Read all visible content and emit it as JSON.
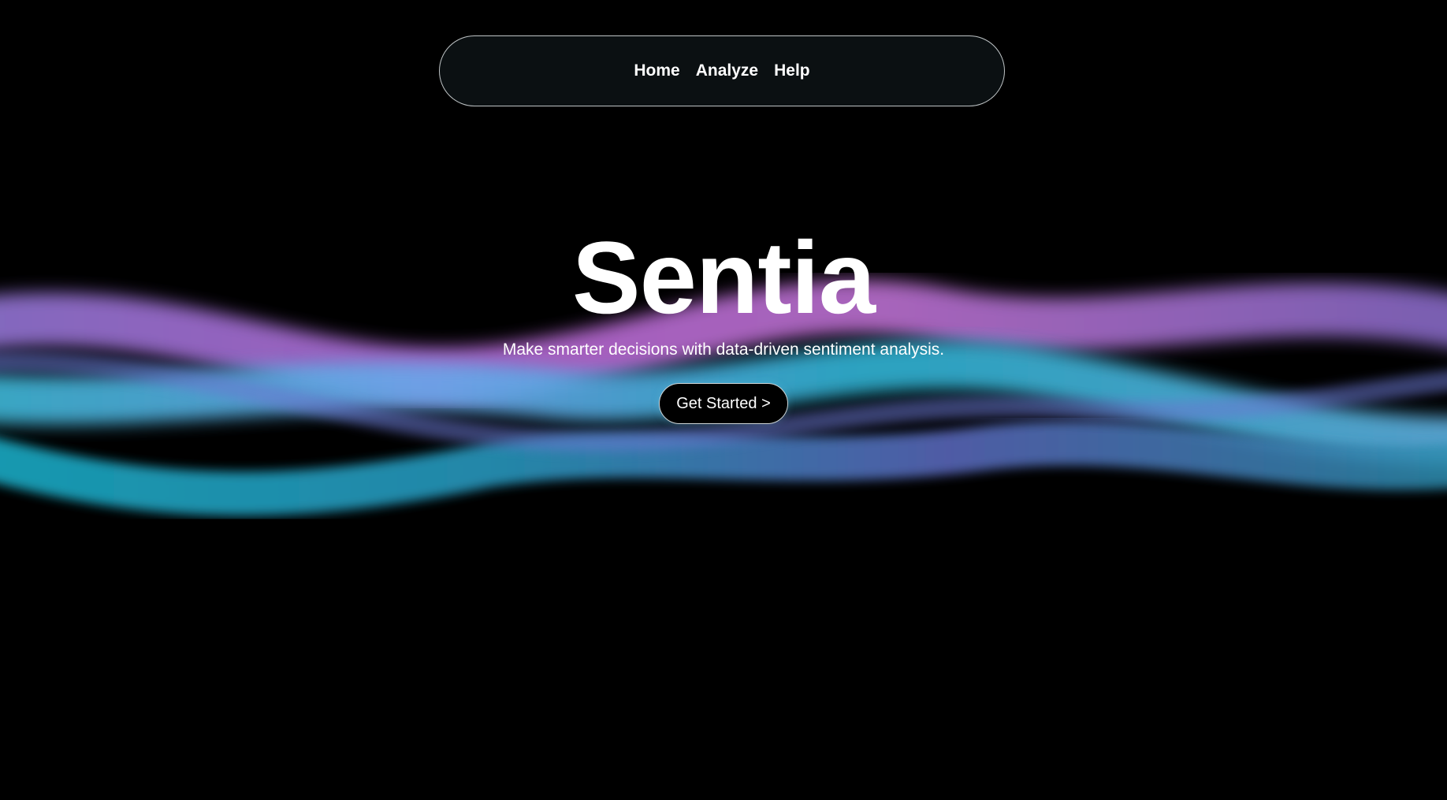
{
  "nav": {
    "items": [
      {
        "label": "Home"
      },
      {
        "label": "Analyze"
      },
      {
        "label": "Help"
      }
    ]
  },
  "hero": {
    "title": "Sentia",
    "subtitle": "Make smarter decisions with data-driven sentiment analysis.",
    "cta_label": "Get Started >"
  },
  "theme": {
    "background": "#000000",
    "nav_background": "#0b1012",
    "nav_border": "#bfc4c6",
    "text": "#ffffff",
    "wave_colors": [
      "#b26cdf",
      "#6aa6e8",
      "#22b5d2",
      "#5e6bc2",
      "#2b8fb0"
    ]
  }
}
